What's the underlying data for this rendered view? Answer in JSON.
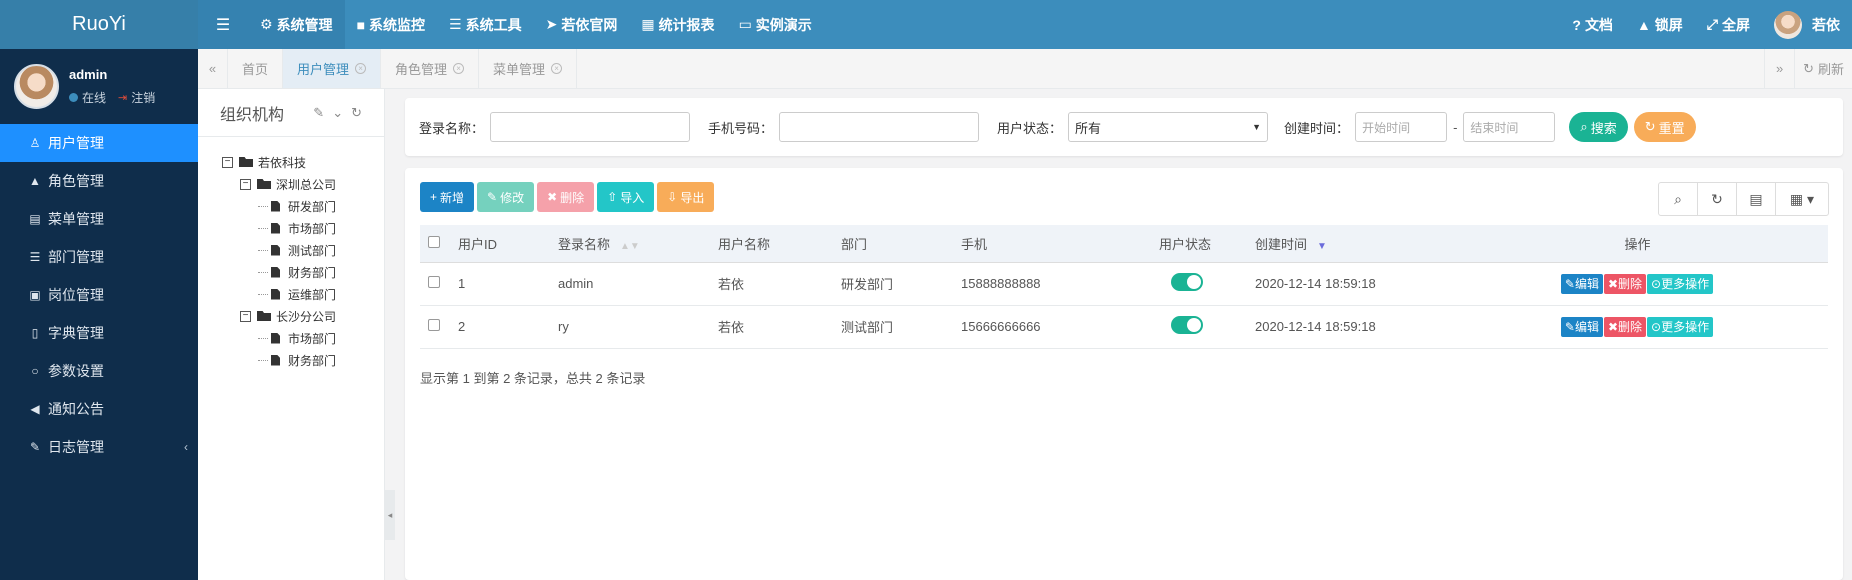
{
  "app": {
    "brand": "RuoYi"
  },
  "topnav": {
    "items": [
      {
        "icon": "gear-icon",
        "glyph": "⚙",
        "label": "系统管理",
        "active": true
      },
      {
        "icon": "video-icon",
        "glyph": "■",
        "label": "系统监控"
      },
      {
        "icon": "list-icon",
        "glyph": "☰",
        "label": "系统工具"
      },
      {
        "icon": "send-icon",
        "glyph": "➤",
        "label": "若依官网"
      },
      {
        "icon": "chart-icon",
        "glyph": "▦",
        "label": "统计报表"
      },
      {
        "icon": "monitor-icon",
        "glyph": "▭",
        "label": "实例演示"
      }
    ],
    "right": [
      {
        "icon": "help-icon",
        "glyph": "?",
        "label": "文档"
      },
      {
        "icon": "lock-icon",
        "glyph": "🔒",
        "label": "锁屏"
      },
      {
        "icon": "fullscreen-icon",
        "glyph": "⤢",
        "label": "全屏"
      }
    ],
    "user": "若依"
  },
  "sidebar": {
    "user": {
      "name": "admin",
      "status": "在线",
      "logout": "注销"
    },
    "items": [
      {
        "glyph": "👤",
        "label": "用户管理",
        "active": true,
        "icon": "user-icon"
      },
      {
        "glyph": "🔒",
        "label": "角色管理",
        "icon": "role-icon"
      },
      {
        "glyph": "▤",
        "label": "菜单管理",
        "icon": "menu-icon"
      },
      {
        "glyph": "☰",
        "label": "部门管理",
        "icon": "dept-icon"
      },
      {
        "glyph": "▣",
        "label": "岗位管理",
        "icon": "post-icon"
      },
      {
        "glyph": "⌂",
        "label": "字典管理",
        "icon": "bookmark-icon"
      },
      {
        "glyph": "✲",
        "label": "参数设置",
        "icon": "settings-icon"
      },
      {
        "glyph": "📢",
        "label": "通知公告",
        "icon": "bullhorn-icon"
      },
      {
        "glyph": "✎",
        "label": "日志管理",
        "icon": "log-icon",
        "caret": "‹"
      }
    ]
  },
  "tabs": {
    "items": [
      {
        "label": "首页",
        "closable": false
      },
      {
        "label": "用户管理",
        "closable": true,
        "active": true
      },
      {
        "label": "角色管理",
        "closable": true
      },
      {
        "label": "菜单管理",
        "closable": true
      }
    ],
    "refresh": "刷新"
  },
  "org": {
    "title": "组织机构",
    "tree": [
      {
        "label": "若依科技",
        "level": 0,
        "type": "folder",
        "sw": "−"
      },
      {
        "label": "深圳总公司",
        "level": 1,
        "type": "folder",
        "sw": "−"
      },
      {
        "label": "研发部门",
        "level": 2,
        "type": "file"
      },
      {
        "label": "市场部门",
        "level": 2,
        "type": "file"
      },
      {
        "label": "测试部门",
        "level": 2,
        "type": "file"
      },
      {
        "label": "财务部门",
        "level": 2,
        "type": "file"
      },
      {
        "label": "运维部门",
        "level": 2,
        "type": "file"
      },
      {
        "label": "长沙分公司",
        "level": 1,
        "type": "folder",
        "sw": "−"
      },
      {
        "label": "市场部门",
        "level": 2,
        "type": "file"
      },
      {
        "label": "财务部门",
        "level": 2,
        "type": "file"
      }
    ]
  },
  "search": {
    "login_label": "登录名称：",
    "phone_label": "手机号码：",
    "status_label": "用户状态：",
    "status_value": "所有",
    "time_label": "创建时间：",
    "start_placeholder": "开始时间",
    "end_placeholder": "结束时间",
    "dash": "-",
    "search_btn": "搜索",
    "reset_btn": "重置"
  },
  "toolbar": {
    "add": "新增",
    "edit": "修改",
    "del": "删除",
    "import": "导入",
    "export": "导出"
  },
  "table": {
    "headers": [
      "用户ID",
      "登录名称",
      "用户名称",
      "部门",
      "手机",
      "用户状态",
      "创建时间",
      "操作"
    ],
    "rows": [
      {
        "id": "1",
        "login": "admin",
        "name": "若依",
        "dept": "研发部门",
        "phone": "15888888888",
        "status_on": true,
        "created": "2020-12-14 18:59:18"
      },
      {
        "id": "2",
        "login": "ry",
        "name": "若依",
        "dept": "测试部门",
        "phone": "15666666666",
        "status_on": true,
        "created": "2020-12-14 18:59:18"
      }
    ],
    "ops": {
      "edit": "编辑",
      "del": "删除",
      "more": "更多操作"
    },
    "footer": "显示第 1 到第 2 条记录，总共 2 条记录"
  },
  "colors": {
    "accent": "#3c8dbc",
    "sidebar": "#0f2d4b",
    "active": "#1e90ff",
    "green": "#1ab394",
    "orange": "#f8ac59",
    "red": "#ed5565",
    "cyan": "#23c6c8",
    "blue": "#1c84c6"
  }
}
